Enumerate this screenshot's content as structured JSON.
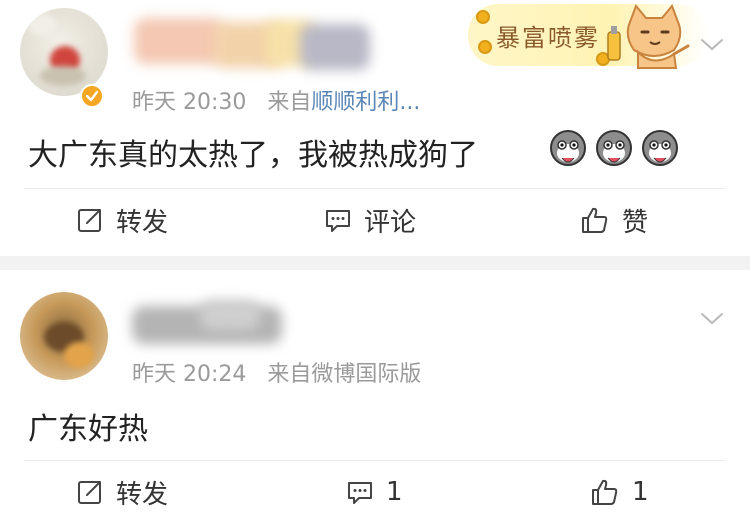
{
  "posts": [
    {
      "timestamp": "昨天 20:30",
      "source_prefix": "来自",
      "source_name": "顺顺利利...",
      "content": "大广东真的太热了，我被热成狗了",
      "emojis": [
        "husky-emoji",
        "husky-emoji",
        "husky-emoji"
      ],
      "badge_text": "暴富喷雾",
      "actions": {
        "repost_label": "转发",
        "comment_label": "评论",
        "like_label": "赞"
      }
    },
    {
      "timestamp": "昨天 20:24",
      "source_prefix": "来自",
      "source_name": "微博国际版",
      "content": "广东好热",
      "actions": {
        "repost_label": "转发",
        "comment_count": "1",
        "like_count": "1"
      }
    }
  ],
  "colors": {
    "meta_gray": "#9a9a9a",
    "source_blue": "#5a86b6",
    "separator": "#f2f2f2",
    "verified_orange": "#f5a623"
  }
}
